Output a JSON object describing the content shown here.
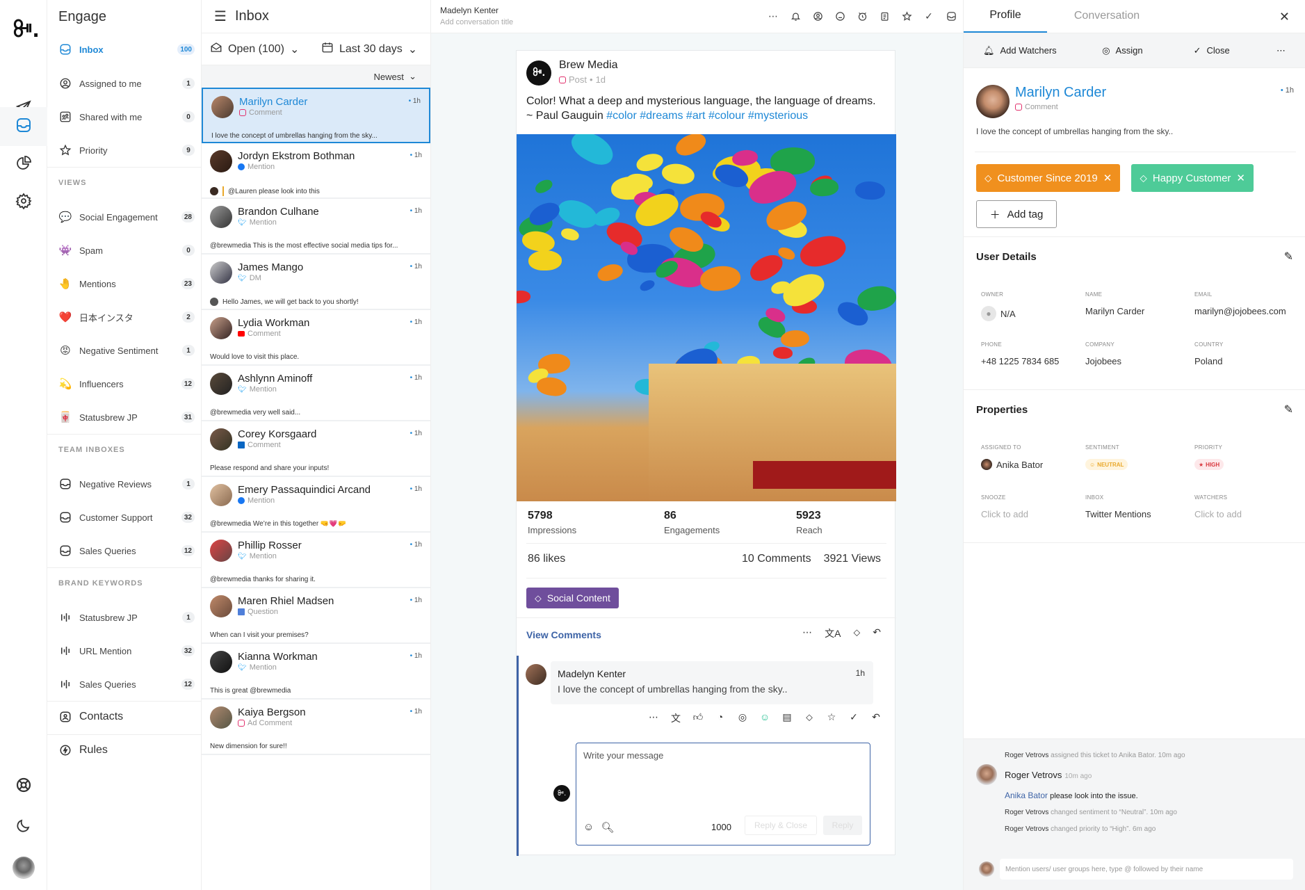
{
  "rail": {
    "logo": "ꔻ.",
    "items": [
      {
        "name": "publish",
        "icon": "paper-plane-icon"
      },
      {
        "name": "engage",
        "icon": "inbox-tray-icon",
        "active": true
      },
      {
        "name": "analytics",
        "icon": "pie-chart-icon"
      },
      {
        "name": "settings",
        "icon": "gear-icon"
      }
    ],
    "bottom": [
      {
        "name": "help",
        "icon": "lifebuoy-icon"
      },
      {
        "name": "dark-mode",
        "icon": "moon-icon"
      }
    ]
  },
  "nav": {
    "title": "Engage",
    "main_items": [
      {
        "label": "Inbox",
        "count": "100",
        "icon": "inbox-tray-icon",
        "active": true
      },
      {
        "label": "Assigned to me",
        "count": "1",
        "icon": "user-circle-icon"
      },
      {
        "label": "Shared with me",
        "count": "0",
        "icon": "shared-users-icon"
      },
      {
        "label": "Priority",
        "count": "9",
        "icon": "star-icon"
      }
    ],
    "views_label": "VIEWS",
    "views": [
      {
        "label": "Social Engagement",
        "count": "28",
        "emoji": "💬"
      },
      {
        "label": "Spam",
        "count": "0",
        "emoji": "👾"
      },
      {
        "label": "Mentions",
        "count": "23",
        "emoji": "🤚"
      },
      {
        "label": "日本インスタ",
        "count": "2",
        "emoji": "❤️"
      },
      {
        "label": "Negative Sentiment",
        "count": "1",
        "emoji": "😡"
      },
      {
        "label": "Influencers",
        "count": "12",
        "emoji": "💫"
      },
      {
        "label": "Statusbrew JP",
        "count": "31",
        "emoji": "🀄"
      }
    ],
    "team_label": "TEAM INBOXES",
    "team": [
      {
        "label": "Negative Reviews",
        "count": "1"
      },
      {
        "label": "Customer Support",
        "count": "32"
      },
      {
        "label": "Sales Queries",
        "count": "12"
      }
    ],
    "brand_label": "BRAND KEYWORDS",
    "brand": [
      {
        "label": "Statusbrew JP",
        "count": "1"
      },
      {
        "label": "URL Mention",
        "count": "32"
      },
      {
        "label": "Sales Queries",
        "count": "12"
      }
    ],
    "contacts": "Contacts",
    "rules": "Rules"
  },
  "list": {
    "title": "Inbox",
    "status_filter": "Open (100)",
    "date_filter": "Last 30 days",
    "sort": "Newest",
    "conversations": [
      {
        "name": "Marilyn Carder",
        "platform": "ig",
        "type": "Comment",
        "time": "1h",
        "message": "I love the concept of umbrellas hanging from the sky...",
        "selected": true
      },
      {
        "name": "Jordyn Ekstrom Bothman",
        "platform": "fb",
        "type": "Mention",
        "time": "1h",
        "message": "@Lauren please look into this",
        "note": true
      },
      {
        "name": "Brandon Culhane",
        "platform": "tw",
        "type": "Mention",
        "time": "1h",
        "message": "@brewmedia This is the most effective social media tips for..."
      },
      {
        "name": "James Mango",
        "platform": "tw",
        "type": "DM",
        "time": "1h",
        "message": "Hello James, we will get back to you shortly!",
        "reply_av": true
      },
      {
        "name": "Lydia Workman",
        "platform": "yt",
        "type": "Comment",
        "time": "1h",
        "message": "Would love to visit this place."
      },
      {
        "name": "Ashlynn Aminoff",
        "platform": "tw",
        "type": "Mention",
        "time": "1h",
        "message": "@brewmedia very well said..."
      },
      {
        "name": "Corey Korsgaard",
        "platform": "li",
        "type": "Comment",
        "time": "1h",
        "message": "Please respond and share your inputs!"
      },
      {
        "name": "Emery Passaquindici Arcand",
        "platform": "fb",
        "type": "Mention",
        "time": "1h",
        "message": "@brewmedia We’re in this together 🤜💗🤛"
      },
      {
        "name": "Phillip Rosser",
        "platform": "tw",
        "type": "Mention",
        "time": "1h",
        "message": "@brewmedia thanks for sharing it."
      },
      {
        "name": "Maren Rhiel Madsen",
        "platform": "gm",
        "type": "Question",
        "time": "1h",
        "message": "When can I visit your premises?"
      },
      {
        "name": "Kianna Workman",
        "platform": "tw",
        "type": "Mention",
        "time": "1h",
        "message": "This is great @brewmedia"
      },
      {
        "name": "Kaiya Bergson",
        "platform": "ig",
        "type": "Ad Comment",
        "time": "1h",
        "message": "New dimension for sure!!"
      }
    ]
  },
  "center": {
    "contact_name": "Madelyn Kenter",
    "title_placeholder": "Add conversation title",
    "toolbar": [
      "more-icon",
      "bell-icon",
      "user-circle-icon",
      "smiley-icon",
      "alarm-clock-icon",
      "clipboard-icon",
      "star-icon",
      "check-icon",
      "inbox-tray-icon"
    ],
    "post": {
      "author": "Brew Media",
      "type": "Post",
      "age": "1d",
      "text": "Color! What a deep and mysterious language, the language of dreams. ~ Paul Gauguin ",
      "hashtags": "#color #dreams #art #colour #mysterious",
      "stats": [
        {
          "value": "5798",
          "label": "Impressions"
        },
        {
          "value": "86",
          "label": "Engagements"
        },
        {
          "value": "5923",
          "label": "Reach"
        }
      ],
      "likes": "86 likes",
      "comments": "10 Comments",
      "views": "3921 Views",
      "tag": "Social Content",
      "tag_color": "#6f4e9c",
      "view_comments": "View Comments"
    },
    "comment": {
      "author": "Madelyn Kenter",
      "time": "1h",
      "text": "I love the concept of umbrellas hanging from the sky.."
    },
    "composer": {
      "placeholder": "Write your message",
      "char_count": "1000",
      "reply_close": "Reply & Close",
      "reply": "Reply"
    }
  },
  "right": {
    "tabs": [
      "Profile",
      "Conversation"
    ],
    "actions": {
      "watchers": "Add Watchers",
      "assign": "Assign",
      "close": "Close"
    },
    "profile": {
      "name": "Marilyn Carder",
      "type": "Comment",
      "time": "1h",
      "message": "I love the concept of umbrellas hanging from the sky.."
    },
    "tags": [
      {
        "label": "Customer Since 2019",
        "color": "#f0901e"
      },
      {
        "label": "Happy Customer",
        "color": "#4ecb98"
      }
    ],
    "add_tag": "Add tag",
    "user_details": {
      "title": "User Details",
      "owner_label": "OWNER",
      "owner": "N/A",
      "name_label": "NAME",
      "name": "Marilyn Carder",
      "email_label": "EMAIL",
      "email": "marilyn@jojobees.com",
      "phone_label": "PHONE",
      "phone": "+48 1225 7834 685",
      "company_label": "COMPANY",
      "company": "Jojobees",
      "country_label": "COUNTRY",
      "country": "Poland"
    },
    "properties": {
      "title": "Properties",
      "assigned_label": "ASSIGNED TO",
      "assigned": "Anika Bator",
      "sentiment_label": "SENTIMENT",
      "sentiment": "NEUTRAL",
      "priority_label": "PRIORITY",
      "priority": "HIGH",
      "snooze_label": "SNOOZE",
      "snooze": "Click to add",
      "inbox_label": "INBOX",
      "inbox": "Twitter Mentions",
      "watchers_label": "WATCHERS",
      "watchers": "Click to add"
    },
    "activity": {
      "line1_actor": "Roger Vetrovs",
      "line1_text": " assigned this ticket to Anika Bator.  10m ago",
      "note_author": "Roger Vetrovs",
      "note_time": "10m ago",
      "note_mention": "Anika Bator",
      "note_text": " please look into the issue.",
      "line2_actor": "Roger Vetrovs",
      "line2_text": " changed sentiment to “Neutral”. 10m ago",
      "line3_actor": "Roger Vetrovs",
      "line3_text": " changed priority to “High”. 6m ago",
      "input_placeholder": "Mention users/ user groups here, type @ followed by their name"
    }
  }
}
